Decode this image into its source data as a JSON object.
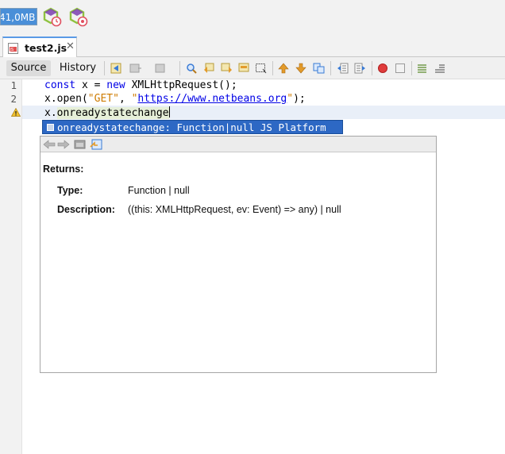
{
  "toolbar": {
    "memory_label": "41,0MB",
    "colors": {
      "memory_bg": "#4a8fd8",
      "hex_green": "#8fc23f",
      "hex_purple": "#7b3fb0",
      "clock_red": "#e05060"
    }
  },
  "tab": {
    "filename": "test2.js",
    "close_glyph": "✕"
  },
  "editor_toolbar": {
    "source_label": "Source",
    "history_label": "History"
  },
  "editor": {
    "line_numbers": [
      "1",
      "2"
    ],
    "line1": {
      "kw1": "const",
      "mid1": " x = ",
      "kw2": "new",
      "rest": " XMLHttpRequest();"
    },
    "line2": {
      "pre": "x.open(",
      "str1": "\"GET\"",
      "comma": ", ",
      "q1": "\"",
      "url": "https://www.netbeans.org",
      "q2": "\"",
      "post": ");"
    },
    "line3": {
      "pre": "x.",
      "member": "onreadystatechange"
    }
  },
  "completion": {
    "item_text": "onreadystatechange: Function|null JS Platform"
  },
  "docs": {
    "returns_label": "Returns:",
    "type_label": "Type:",
    "type_value": "Function | null",
    "description_label": "Description:",
    "description_value": "((this: XMLHttpRequest, ev: Event) => any) | null"
  }
}
